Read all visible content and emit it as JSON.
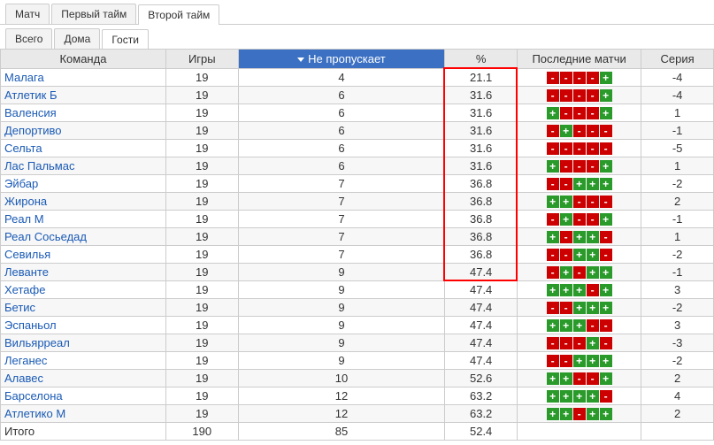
{
  "tabs_top": [
    {
      "label": "Матч",
      "active": false
    },
    {
      "label": "Первый тайм",
      "active": false
    },
    {
      "label": "Второй тайм",
      "active": true
    }
  ],
  "tabs_sub": [
    {
      "label": "Всего",
      "active": false
    },
    {
      "label": "Дома",
      "active": false
    },
    {
      "label": "Гости",
      "active": true
    }
  ],
  "headers": {
    "team": "Команда",
    "games": "Игры",
    "miss": "Не пропускает",
    "pct": "%",
    "last": "Последние матчи",
    "streak": "Серия"
  },
  "rows": [
    {
      "team": "Малага",
      "games": 19,
      "miss": 4,
      "pct": "21.1",
      "marks": [
        "-",
        "-",
        "-",
        "-",
        "+"
      ],
      "streak": -4,
      "hl": true
    },
    {
      "team": "Атлетик Б",
      "games": 19,
      "miss": 6,
      "pct": "31.6",
      "marks": [
        "-",
        "-",
        "-",
        "-",
        "+"
      ],
      "streak": -4,
      "hl": true
    },
    {
      "team": "Валенсия",
      "games": 19,
      "miss": 6,
      "pct": "31.6",
      "marks": [
        "+",
        "-",
        "-",
        "-",
        "+"
      ],
      "streak": 1,
      "hl": true
    },
    {
      "team": "Депортиво",
      "games": 19,
      "miss": 6,
      "pct": "31.6",
      "marks": [
        "-",
        "+",
        "-",
        "-",
        "-"
      ],
      "streak": -1,
      "hl": true
    },
    {
      "team": "Сельта",
      "games": 19,
      "miss": 6,
      "pct": "31.6",
      "marks": [
        "-",
        "-",
        "-",
        "-",
        "-"
      ],
      "streak": -5,
      "hl": true
    },
    {
      "team": "Лас Пальмас",
      "games": 19,
      "miss": 6,
      "pct": "31.6",
      "marks": [
        "+",
        "-",
        "-",
        "-",
        "+"
      ],
      "streak": 1,
      "hl": true
    },
    {
      "team": "Эйбар",
      "games": 19,
      "miss": 7,
      "pct": "36.8",
      "marks": [
        "-",
        "-",
        "+",
        "+",
        "+"
      ],
      "streak": -2,
      "hl": true
    },
    {
      "team": "Жирона",
      "games": 19,
      "miss": 7,
      "pct": "36.8",
      "marks": [
        "+",
        "+",
        "-",
        "-",
        "-"
      ],
      "streak": 2,
      "hl": true
    },
    {
      "team": "Реал М",
      "games": 19,
      "miss": 7,
      "pct": "36.8",
      "marks": [
        "-",
        "+",
        "-",
        "-",
        "+"
      ],
      "streak": -1,
      "hl": true
    },
    {
      "team": "Реал Сосьедад",
      "games": 19,
      "miss": 7,
      "pct": "36.8",
      "marks": [
        "+",
        "-",
        "+",
        "+",
        "-"
      ],
      "streak": 1,
      "hl": true
    },
    {
      "team": "Севилья",
      "games": 19,
      "miss": 7,
      "pct": "36.8",
      "marks": [
        "-",
        "-",
        "+",
        "+",
        "-"
      ],
      "streak": -2,
      "hl": true
    },
    {
      "team": "Леванте",
      "games": 19,
      "miss": 9,
      "pct": "47.4",
      "marks": [
        "-",
        "+",
        "-",
        "+",
        "+"
      ],
      "streak": -1,
      "hl": true
    },
    {
      "team": "Хетафе",
      "games": 19,
      "miss": 9,
      "pct": "47.4",
      "marks": [
        "+",
        "+",
        "+",
        "-",
        "+"
      ],
      "streak": 3,
      "hl": false
    },
    {
      "team": "Бетис",
      "games": 19,
      "miss": 9,
      "pct": "47.4",
      "marks": [
        "-",
        "-",
        "+",
        "+",
        "+"
      ],
      "streak": -2,
      "hl": false
    },
    {
      "team": "Эспаньол",
      "games": 19,
      "miss": 9,
      "pct": "47.4",
      "marks": [
        "+",
        "+",
        "+",
        "-",
        "-"
      ],
      "streak": 3,
      "hl": false
    },
    {
      "team": "Вильярреал",
      "games": 19,
      "miss": 9,
      "pct": "47.4",
      "marks": [
        "-",
        "-",
        "-",
        "+",
        "-"
      ],
      "streak": -3,
      "hl": false
    },
    {
      "team": "Леганес",
      "games": 19,
      "miss": 9,
      "pct": "47.4",
      "marks": [
        "-",
        "-",
        "+",
        "+",
        "+"
      ],
      "streak": -2,
      "hl": false
    },
    {
      "team": "Алавес",
      "games": 19,
      "miss": 10,
      "pct": "52.6",
      "marks": [
        "+",
        "+",
        "-",
        "-",
        "+"
      ],
      "streak": 2,
      "hl": false
    },
    {
      "team": "Барселона",
      "games": 19,
      "miss": 12,
      "pct": "63.2",
      "marks": [
        "+",
        "+",
        "+",
        "+",
        "-"
      ],
      "streak": 4,
      "hl": false
    },
    {
      "team": "Атлетико М",
      "games": 19,
      "miss": 12,
      "pct": "63.2",
      "marks": [
        "+",
        "+",
        "-",
        "+",
        "+"
      ],
      "streak": 2,
      "hl": false
    }
  ],
  "total": {
    "team": "Итого",
    "games": 190,
    "miss": 85,
    "pct": "52.4"
  },
  "highlight_color": "#ff0000"
}
